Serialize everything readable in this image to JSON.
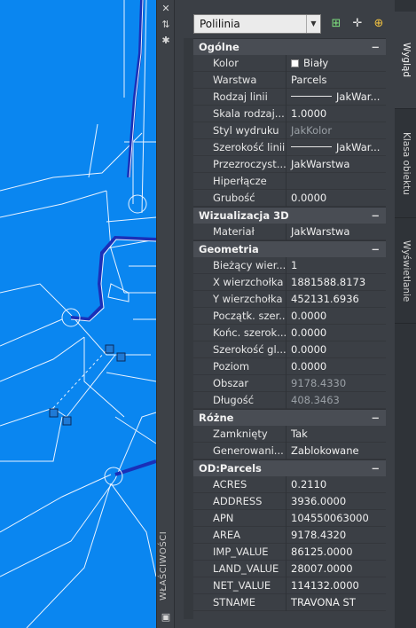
{
  "palette_title": "WŁAŚCIWOŚCI",
  "object_type": "Polilinia",
  "toolbar": {
    "quick_select_icon": "quick-select-icon",
    "select_objects_icon": "select-objects-icon",
    "pickadd_icon": "pickadd-toggle-icon"
  },
  "tabs": [
    "Wygląd",
    "Klasa obiektu",
    "Wyświetlanie"
  ],
  "sections": [
    {
      "title": "Ogólne",
      "rows": [
        {
          "key": "Kolor",
          "value": "Biały",
          "swatch": true
        },
        {
          "key": "Warstwa",
          "value": "Parcels"
        },
        {
          "key": "Rodzaj linii",
          "value": "JakWar...",
          "line": true
        },
        {
          "key": "Skala rodzaj...",
          "value": "1.0000"
        },
        {
          "key": "Styl wydruku",
          "value": "JakKolor",
          "dim": true
        },
        {
          "key": "Szerokość linii",
          "value": "JakWar...",
          "line": true
        },
        {
          "key": "Przezroczyst...",
          "value": "JakWarstwa"
        },
        {
          "key": "Hiperłącze",
          "value": ""
        },
        {
          "key": "Grubość",
          "value": "0.0000"
        }
      ]
    },
    {
      "title": "Wizualizacja 3D",
      "rows": [
        {
          "key": "Materiał",
          "value": "JakWarstwa"
        }
      ]
    },
    {
      "title": "Geometria",
      "rows": [
        {
          "key": "Bieżący wier...",
          "value": "1"
        },
        {
          "key": "X wierzchołka",
          "value": "1881588.8173"
        },
        {
          "key": "Y wierzchołka",
          "value": "452131.6936"
        },
        {
          "key": "Początk. szer...",
          "value": "0.0000"
        },
        {
          "key": "Końc. szerok...",
          "value": "0.0000"
        },
        {
          "key": "Szerokość gl...",
          "value": "0.0000"
        },
        {
          "key": "Poziom",
          "value": "0.0000"
        },
        {
          "key": "Obszar",
          "value": "9178.4330",
          "dim": true
        },
        {
          "key": "Długość",
          "value": "408.3463",
          "dim": true
        }
      ]
    },
    {
      "title": "Różne",
      "rows": [
        {
          "key": "Zamknięty",
          "value": "Tak"
        },
        {
          "key": "Generowani...",
          "value": "Zablokowane"
        }
      ]
    },
    {
      "title": "OD:Parcels",
      "rows": [
        {
          "key": "ACRES",
          "value": "0.2110"
        },
        {
          "key": "ADDRESS",
          "value": "3936.0000"
        },
        {
          "key": "APN",
          "value": "104550063000"
        },
        {
          "key": "AREA",
          "value": "9178.4320"
        },
        {
          "key": "IMP_VALUE",
          "value": "86125.0000"
        },
        {
          "key": "LAND_VALUE",
          "value": "28007.0000"
        },
        {
          "key": "NET_VALUE",
          "value": "114132.0000"
        },
        {
          "key": "STNAME",
          "value": "TRAVONA ST"
        }
      ]
    }
  ],
  "collapse_glyph": "−"
}
